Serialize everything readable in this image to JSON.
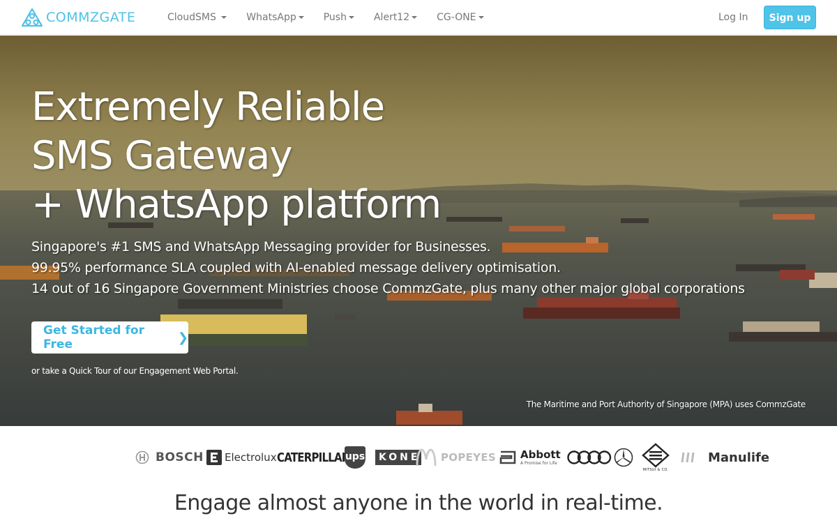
{
  "brand": {
    "name": "COMMZGATE",
    "color": "#4fc1e6"
  },
  "nav": {
    "items": [
      {
        "label": "CloudSMS"
      },
      {
        "label": "WhatsApp"
      },
      {
        "label": "Push"
      },
      {
        "label": "Alert12"
      },
      {
        "label": "CG-ONE"
      }
    ],
    "login": "Log In",
    "signup": "Sign up"
  },
  "hero": {
    "title_lines": [
      "Extremely Reliable",
      "SMS Gateway",
      "+ WhatsApp platform"
    ],
    "sub_lines": [
      "Singapore's #1 SMS and WhatsApp Messaging provider for Businesses.",
      "99.95% performance SLA coupled with AI-enabled message delivery optimisation.",
      "14 out of 16 Singapore Government Ministries choose CommzGate, plus many other major global corporations"
    ],
    "cta": "Get Started for Free",
    "tour": "or take a Quick Tour of our Engagement Web Portal.",
    "caption": "The Maritime and Port Authority of Singapore (MPA) uses CommzGate"
  },
  "logos": {
    "bosch": "BOSCH",
    "electrolux": "Electrolux",
    "caterpillar": "CATERPILLAR",
    "ups": "ups",
    "kone": "KONE",
    "popeyes": "POPEYES",
    "abbott": "Abbott",
    "abbott_tag": "A Promise for Life",
    "mitsui": "MITSUI & CO.",
    "manulife": "Manulife"
  },
  "tagline": "Engage almost anyone in the world in real-time."
}
